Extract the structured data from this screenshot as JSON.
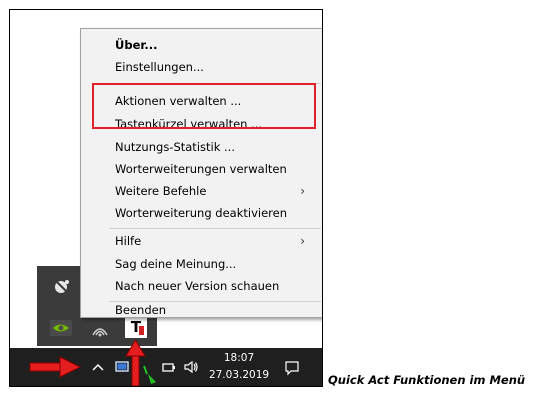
{
  "menu": {
    "items": [
      {
        "label": "Über...",
        "bold": true
      },
      {
        "label": "Einstellungen..."
      },
      {
        "label": "Aktionen verwalten ..."
      },
      {
        "label": "Tastenkürzel verwalten ..."
      },
      {
        "label": "Nutzungs-Statistik ..."
      },
      {
        "label": "Worterweiterungen verwalten"
      },
      {
        "label": "Weitere Befehle",
        "submenu": true
      },
      {
        "label": "Worterweiterung deaktivieren"
      },
      {
        "label": "Hilfe",
        "submenu": true
      },
      {
        "label": "Sag deine Meinung..."
      },
      {
        "label": "Nach neuer Version schauen"
      },
      {
        "label": "Beenden"
      }
    ]
  },
  "tray_popup": {
    "app_icon_text": "T"
  },
  "taskbar": {
    "time": "18:07",
    "date": "27.03.2019"
  },
  "caption": "Quick Act Funktionen im Menü",
  "colors": {
    "highlight": "#e0202a",
    "taskbar": "#1f1f1f",
    "menu_bg": "#f2f2f2"
  }
}
